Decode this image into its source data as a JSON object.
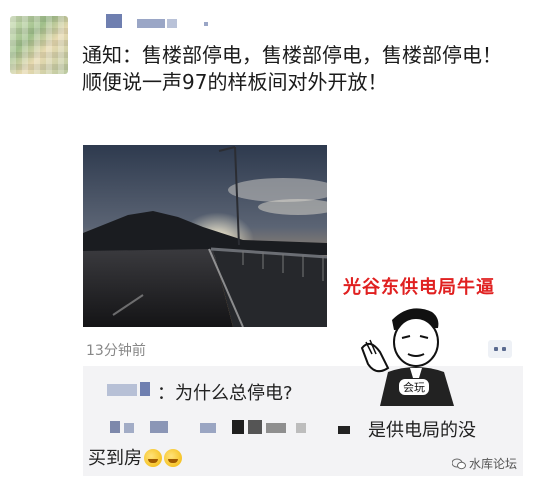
{
  "post": {
    "text": "通知：售楼部停电，售楼部停电，售楼部停电！顺便说一声97的样板间对外开放！",
    "time": "13分钟前"
  },
  "overlay": {
    "caption": "光谷东供电局牛逼",
    "meme_label": "会玩"
  },
  "comments": [
    {
      "text": "：为什么总停电?"
    },
    {
      "text": "是供电局的没"
    },
    {
      "text": "买到房"
    }
  ],
  "watermark": {
    "text": "水库论坛",
    "icon": "wechat-icon"
  },
  "icons": {
    "more": "more-dots-icon",
    "emoji": "cry-laugh-emoji-icon"
  },
  "colors": {
    "caption": "#e02020",
    "name_link": "#5a6f9a",
    "time": "#888888"
  }
}
